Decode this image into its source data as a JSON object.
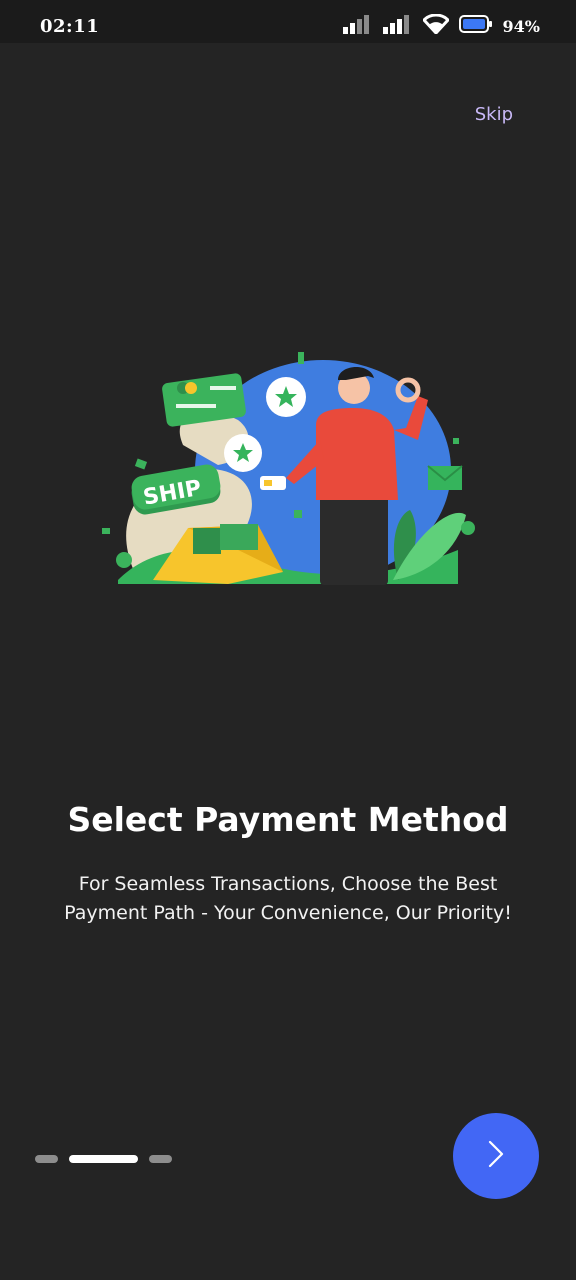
{
  "status_bar": {
    "time": "02:11",
    "battery": "94%",
    "icons": [
      "signal-icon",
      "signal-icon",
      "wifi-icon",
      "battery-icon"
    ]
  },
  "skip_label": "Skip",
  "illustration": {
    "badge_text": "SHIP",
    "description_icon": "payment-illustration"
  },
  "title": "Select Payment Method",
  "subtitle_line1": "For Seamless Transactions, Choose the Best",
  "subtitle_line2": "Payment Path - Your Convenience, Our Priority!",
  "pagination": {
    "total": 3,
    "active_index": 1
  },
  "next_icon": "chevron-right-icon",
  "colors": {
    "background": "#242424",
    "accent": "#4267f5",
    "skip": "#c8b8f6"
  }
}
